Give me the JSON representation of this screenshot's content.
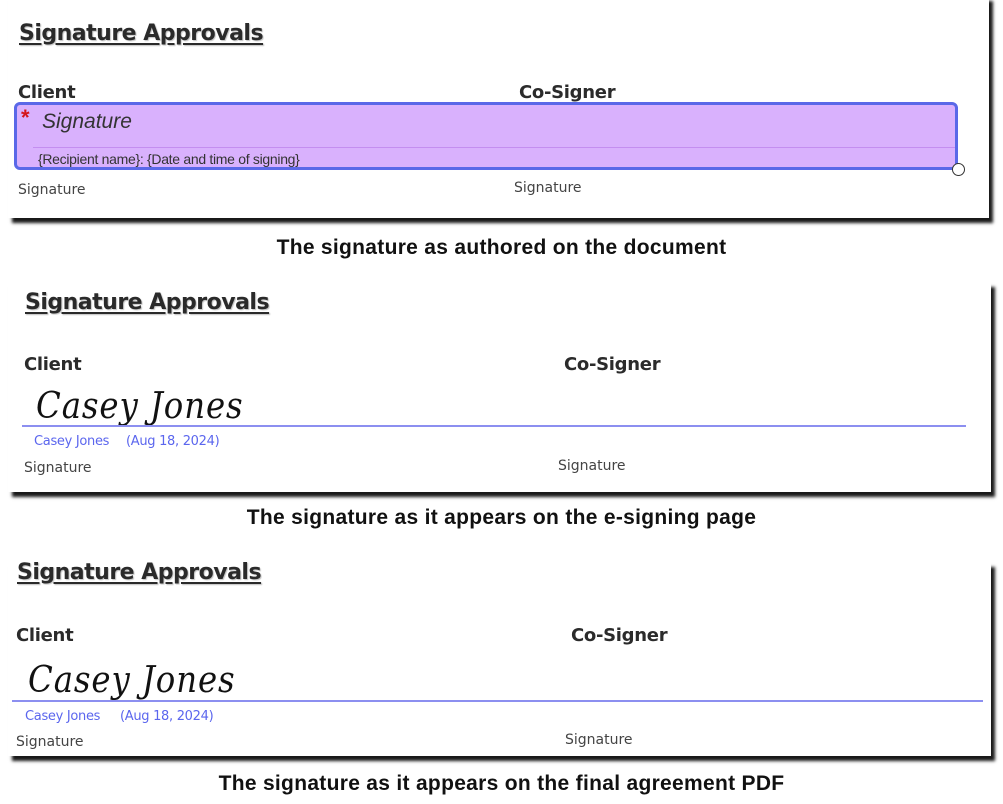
{
  "sections": [
    {
      "heading": "Signature Approvals",
      "client_label": "Client",
      "cosigner_label": "Co-Signer",
      "client_signature_label": "Signature",
      "cosigner_signature_label": "Signature",
      "field": {
        "required_marker": "*",
        "title": "Signature",
        "subtitle": "{Recipient name}: {Date and time of signing}",
        "fill_color": "#d9b1fd",
        "border_color": "#5a68e8"
      },
      "caption": "The signature as authored on the document"
    },
    {
      "heading": "Signature Approvals",
      "client_label": "Client",
      "cosigner_label": "Co-Signer",
      "handwritten_signature": "Casey Jones",
      "signer_name": "Casey Jones",
      "signed_date": "(Aug 18, 2024)",
      "client_signature_label": "Signature",
      "cosigner_signature_label": "Signature",
      "caption": "The signature as it appears on the e-signing page"
    },
    {
      "heading": "Signature Approvals",
      "client_label": "Client",
      "cosigner_label": "Co-Signer",
      "handwritten_signature": "Casey Jones",
      "signer_name": "Casey Jones",
      "signed_date": "(Aug 18, 2024)",
      "client_signature_label": "Signature",
      "cosigner_signature_label": "Signature",
      "caption": "The signature as it appears on the final agreement PDF"
    }
  ],
  "colors": {
    "signature_line": "#8c8ff0",
    "signer_text": "#5b66ee",
    "required_star": "#d4151b"
  }
}
